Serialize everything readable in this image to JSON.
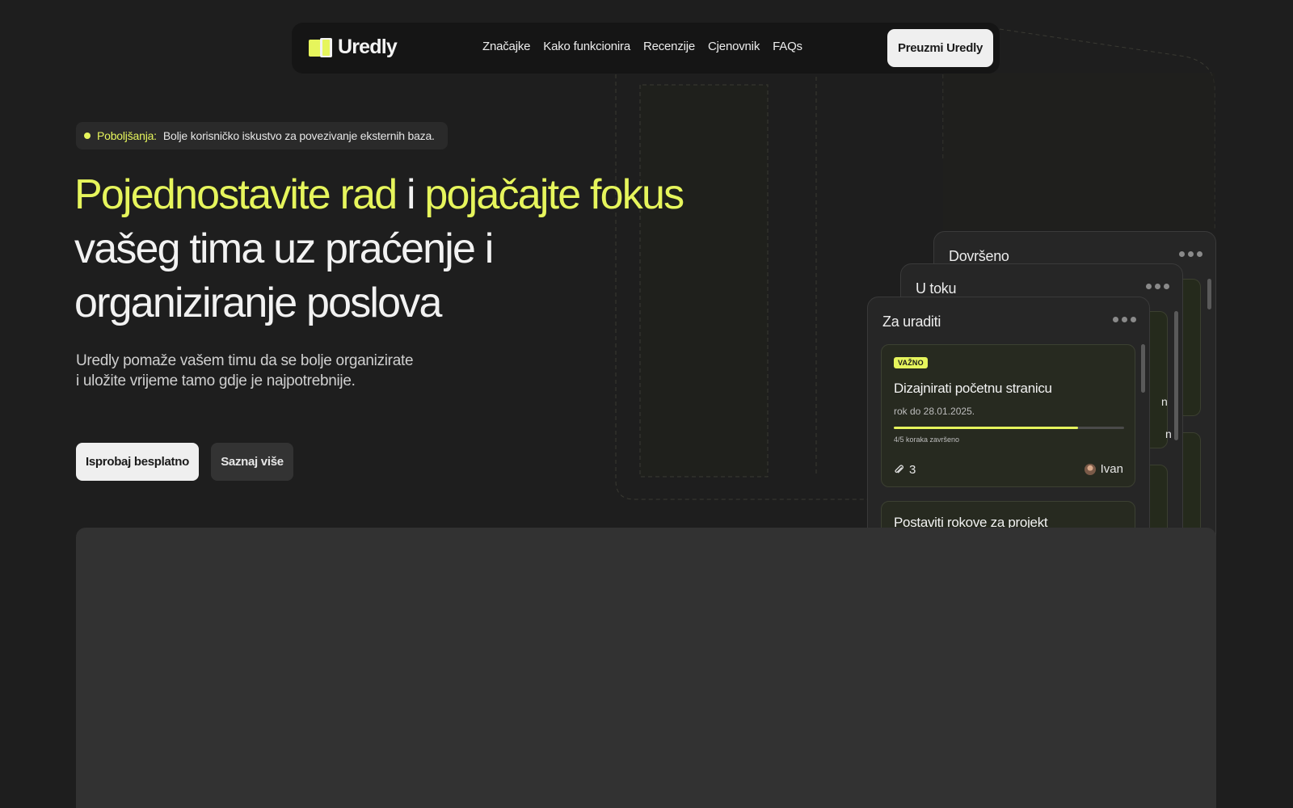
{
  "brand": {
    "name": "Uredly",
    "accent": "#e6f55c"
  },
  "nav": {
    "links": [
      "Značajke",
      "Kako funkcionira",
      "Recenzije",
      "Cjenovnik",
      "FAQs"
    ],
    "cta": "Preuzmi Uredly"
  },
  "announcement": {
    "tag": "Poboljšanja:",
    "text": "Bolje korisničko iskustvo za povezivanje eksternih baza."
  },
  "hero": {
    "title_parts": [
      "Pojednostavite rad",
      " i ",
      "pojačajte fokus",
      " vašeg tima uz praćenje i organiziranje poslova"
    ],
    "subtitle_lines": [
      "Uredly pomaže vašem timu da se bolje organizirate",
      "i uložite vrijeme tamo gdje je najpotrebnije."
    ],
    "primary_button": "Isprobaj besplatno",
    "secondary_button": "Saznaj više"
  },
  "board": {
    "columns": [
      "Dovršeno",
      "U toku",
      "Za uraditi"
    ],
    "peek_fragments": [
      "n",
      "n"
    ],
    "task": {
      "badge": "VAŽNO",
      "title": "Dizajnirati početnu stranicu",
      "due": "rok do 28.01.2025.",
      "progress_label": "4/5 koraka završeno",
      "progress_fraction": 0.8,
      "attachments": "3",
      "assignee": "Ivan"
    },
    "task2": {
      "title": "Postaviti rokove za projekt"
    }
  }
}
